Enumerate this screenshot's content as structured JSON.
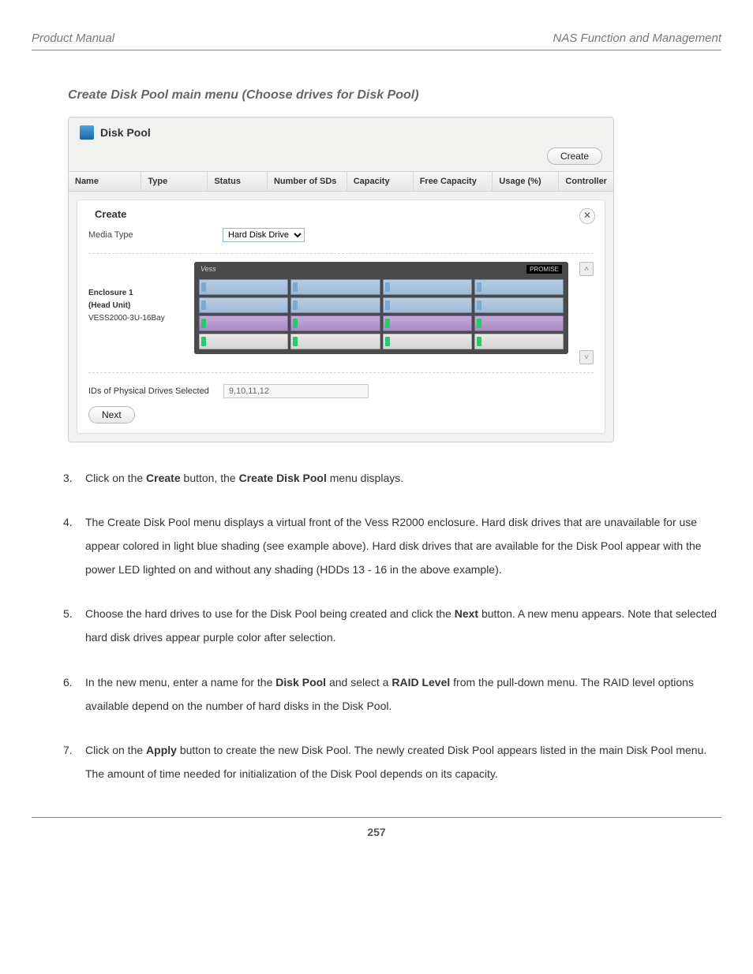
{
  "header": {
    "left": "Product Manual",
    "right": "NAS Function and Management"
  },
  "section_title": "Create Disk Pool main menu (Choose drives for Disk Pool)",
  "screenshot": {
    "title": "Disk Pool",
    "create_btn": "Create",
    "columns": {
      "name": "Name",
      "type": "Type",
      "status": "Status",
      "num": "Number of SDs",
      "cap": "Capacity",
      "free": "Free Capacity",
      "usage": "Usage (%)",
      "ctrl": "Controller"
    },
    "panel": {
      "title": "Create",
      "close": "✕",
      "media_label": "Media Type",
      "media_value": "Hard Disk Drive",
      "enclosure": {
        "line1": "Enclosure 1",
        "line2": "(Head Unit)",
        "line3": "VESS2000-3U-16Bay",
        "brand_left": "Vess",
        "brand_right": "PROMISE"
      },
      "ids_label": "IDs of Physical Drives Selected",
      "ids_value": "9,10,11,12",
      "next_btn": "Next",
      "scroll_up": "˄",
      "scroll_down": "˅"
    }
  },
  "steps": {
    "s3": {
      "pre": "Click on the ",
      "b1": "Create",
      "mid": " button, the ",
      "b2": "Create Disk Pool",
      "post": " menu displays."
    },
    "s4": "The Create Disk Pool menu displays a virtual front of the Vess R2000 enclosure. Hard disk drives that are unavailable for use appear colored in light blue shading (see example above). Hard disk drives that are available for the Disk Pool appear with the power LED lighted on and without any shading (HDDs 13 - 16 in the above example).",
    "s5": {
      "pre": "Choose the hard drives to use for the Disk Pool being created and click the ",
      "b1": "Next",
      "post": " button. A new menu appears. Note that selected hard disk drives appear purple color after selection."
    },
    "s6": {
      "pre": "In the new menu, enter a name for the ",
      "b1": "Disk Pool",
      "mid": " and select a ",
      "b2": "RAID Level",
      "post": " from the pull-down menu. The RAID level options available depend on the number of hard disks in the Disk Pool."
    },
    "s7": {
      "pre": "Click on the ",
      "b1": "Apply",
      "post": " button to create the new Disk Pool. The newly created Disk Pool appears listed in the main Disk Pool menu. The amount of time needed for initialization of the Disk Pool depends on its capacity."
    }
  },
  "page_number": "257"
}
